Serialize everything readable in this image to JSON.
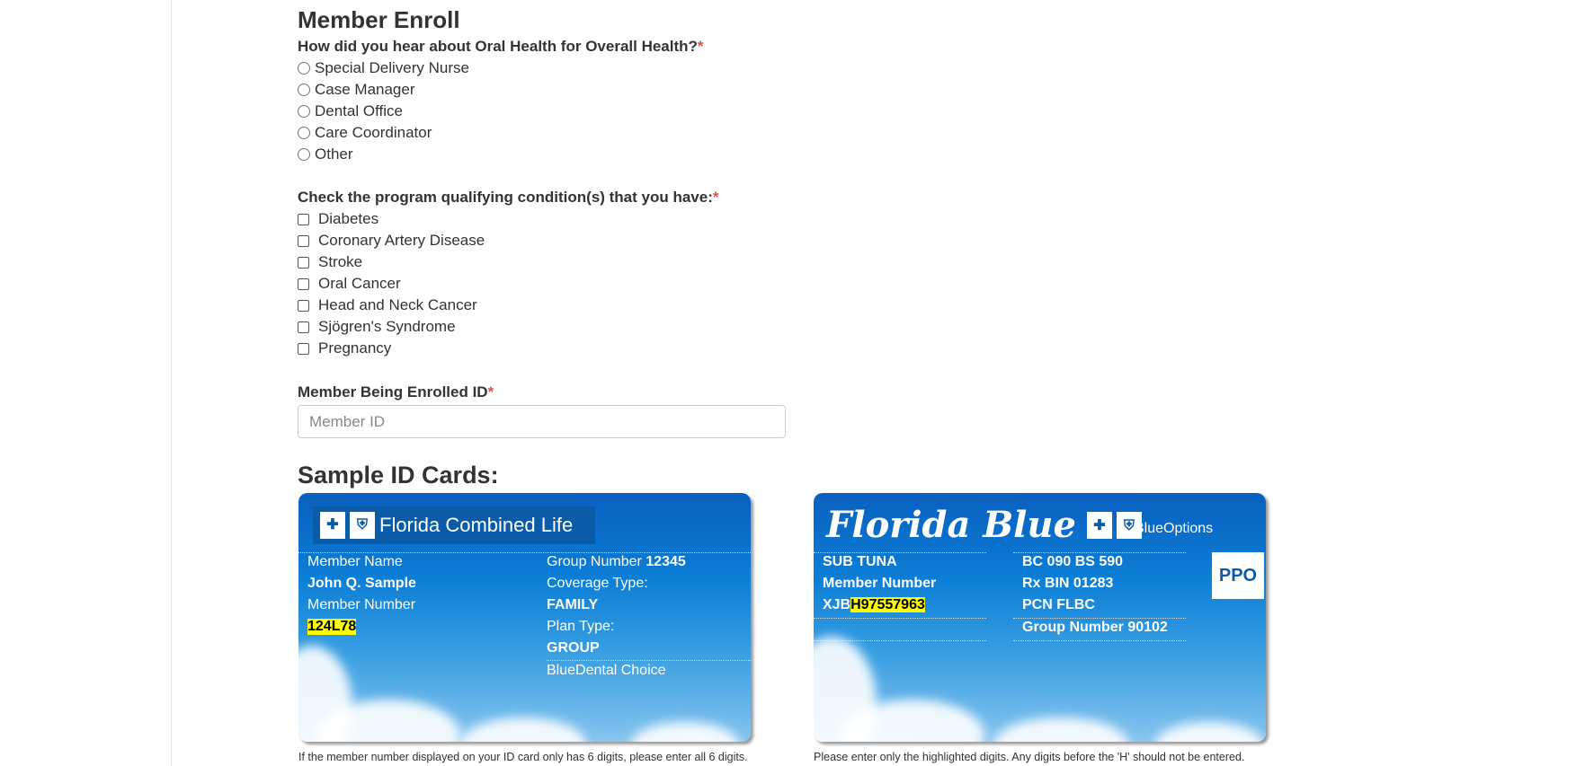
{
  "title": "Member Enroll",
  "q1": {
    "label": "How did you hear about Oral Health for Overall Health?",
    "required": "*",
    "options": [
      "Special Delivery Nurse",
      "Case Manager",
      "Dental Office",
      "Care Coordinator",
      "Other"
    ]
  },
  "q2": {
    "label": "Check the program qualifying condition(s) that you have:",
    "required": "*",
    "options": [
      "Diabetes",
      "Coronary Artery Disease",
      "Stroke",
      "Oral Cancer",
      "Head and Neck Cancer",
      "Sjögren's Syndrome",
      "Pregnancy"
    ]
  },
  "member_id": {
    "label": "Member Being Enrolled ID",
    "required": "*",
    "placeholder": "Member ID"
  },
  "sample_heading": "Sample ID Cards:",
  "card1": {
    "logo": "Florida Combined Life",
    "member_name_label": "Member Name",
    "member_name": "John Q. Sample",
    "member_number_label": "Member Number",
    "member_number": "124L78",
    "group_label": "Group Number",
    "group_number": "12345",
    "coverage_label": "Coverage Type:",
    "coverage": "FAMILY",
    "plan_label": "Plan Type:",
    "plan": "GROUP",
    "product": "BlueDental Choice",
    "caption": "If the member number displayed on your ID card only has 6 digits, please enter all 6 digits."
  },
  "card2": {
    "logo": "Florida Blue",
    "product": "BlueOptions",
    "name": "SUB TUNA",
    "member_number_label": "Member Number",
    "prefix": "XJB",
    "member_number": "H97557963",
    "bc": "BC 090 BS 590",
    "rxbin": "Rx BIN 01283",
    "pcn": "PCN FLBC",
    "group": "Group Number 90102",
    "ppo": "PPO",
    "caption": "Please enter only the highlighted digits. Any digits before the 'H' should not be entered."
  }
}
